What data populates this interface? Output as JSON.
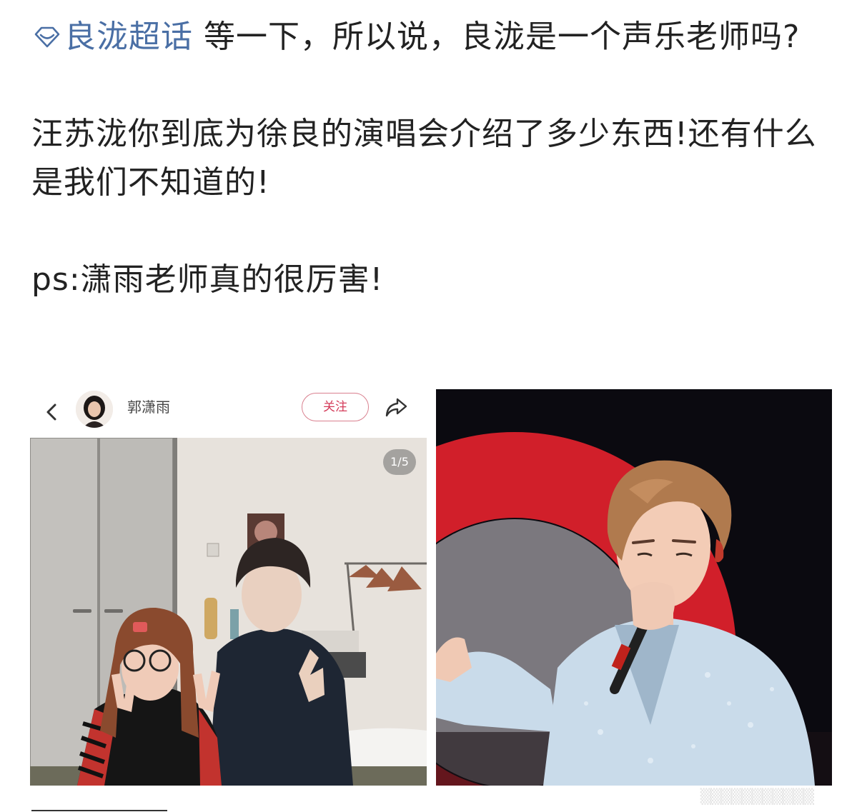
{
  "post": {
    "topic_name": "良泷超话",
    "line1": "等一下，所以说，良泷是一个声乐老师吗?",
    "paragraph2": "汪苏泷你到底为徐良的演唱会介绍了多少东西!还有什么是我们不知道的!",
    "paragraph3": "ps:潇雨老师真的很厉害!"
  },
  "left_card": {
    "username": "郭潇雨",
    "follow_label": "关注",
    "page_counter": "1/5"
  },
  "icons": {
    "topic": "diamond-topic-icon",
    "back": "chevron-left-icon",
    "share": "share-arrow-icon"
  },
  "colors": {
    "topic_link": "#4a6fa5",
    "follow_accent": "#d43c5a",
    "text": "#222222"
  }
}
